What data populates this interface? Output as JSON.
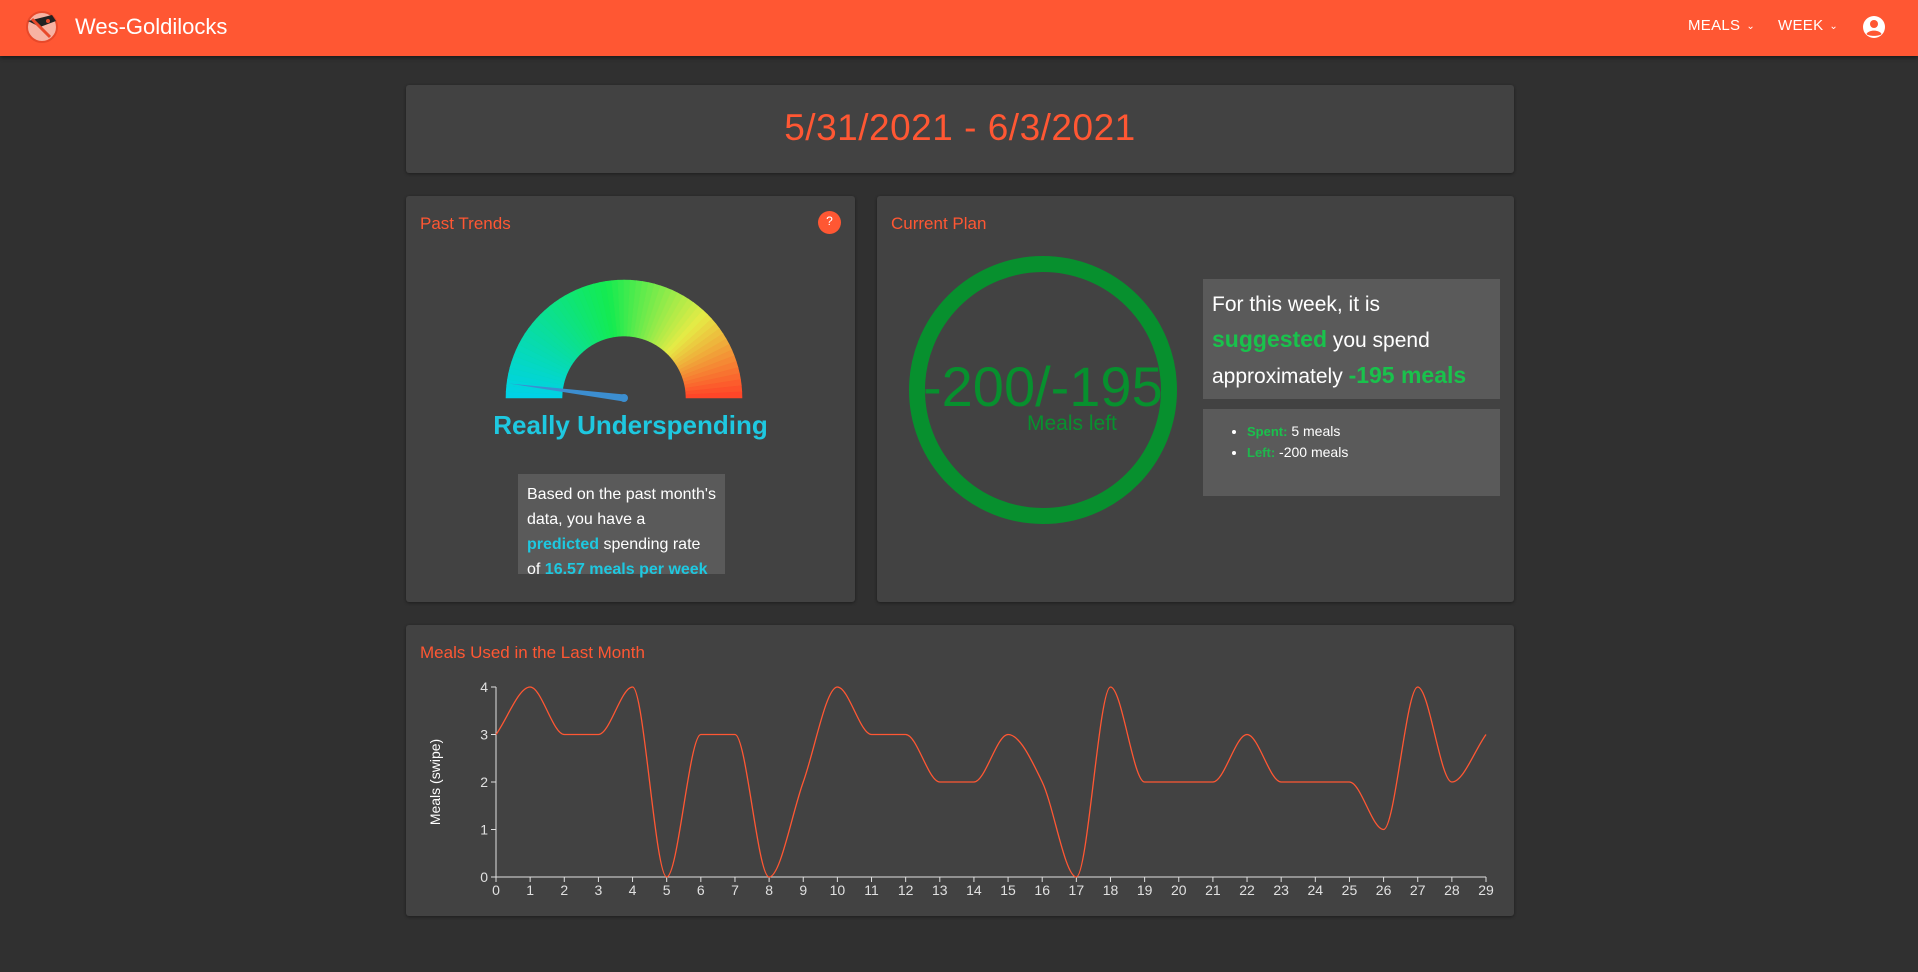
{
  "app": {
    "title": "Wes-Goldilocks",
    "menu_meals": "MEALS",
    "menu_week": "WEEK",
    "brand_color": "#ff5733"
  },
  "date_range": "5/31/2021 - 6/3/2021",
  "trends": {
    "title": "Past Trends",
    "help": "?",
    "gauge_label": "Really Underspending",
    "gauge_level": 0.04,
    "text_before": "Based on the past month's data, you have a ",
    "highlight_predicted": "predicted",
    "text_middle": " spending rate of ",
    "highlight_rate": "16.57 meals per week"
  },
  "plan": {
    "title": "Current Plan",
    "ring_value": "-200/-195",
    "ring_sub": "Meals left",
    "suggest_before": "For this week, it is ",
    "suggest_word": "suggested",
    "suggest_middle": " you spend approximately ",
    "suggest_amount": "-195 meals",
    "spent_label": "Spent:",
    "spent_value": " 5 meals",
    "left_label": "Left:",
    "left_value": " -200 meals"
  },
  "chart_data": {
    "type": "line",
    "title": "Meals Used in the Last Month",
    "xlabel": "",
    "ylabel": "Meals (swipe)",
    "x": [
      0,
      1,
      2,
      3,
      4,
      5,
      6,
      7,
      8,
      9,
      10,
      11,
      12,
      13,
      14,
      15,
      16,
      17,
      18,
      19,
      20,
      21,
      22,
      23,
      24,
      25,
      26,
      27,
      28,
      29
    ],
    "values": [
      3,
      4,
      3,
      3,
      4,
      0,
      3,
      3,
      0,
      2,
      4,
      3,
      3,
      2,
      2,
      3,
      2,
      0,
      4,
      2,
      2,
      2,
      3,
      2,
      2,
      2,
      1,
      4,
      2,
      3
    ],
    "yticks": [
      0,
      1,
      2,
      3,
      4
    ],
    "ylim": [
      0,
      4
    ],
    "xlim": [
      0,
      29
    ],
    "line_color": "#ff5733",
    "grid": false
  }
}
